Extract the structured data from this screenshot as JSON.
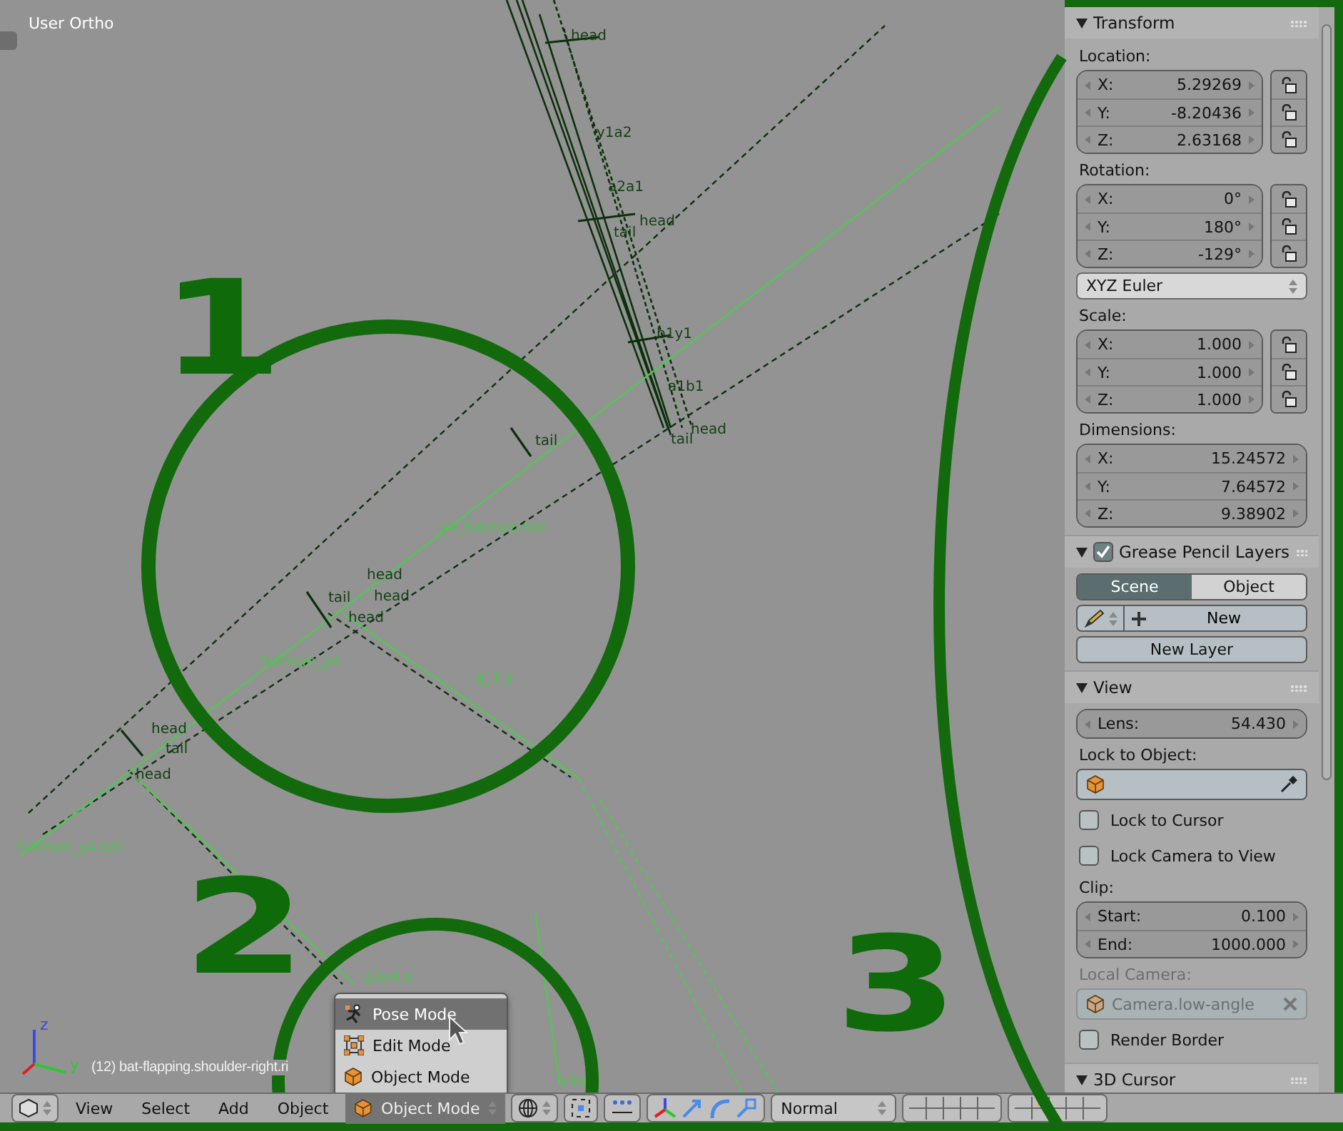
{
  "viewport": {
    "title": "User Ortho",
    "object_info": "(12) bat-flapping.shoulder-right.ri",
    "axis_labels": [
      "z",
      "y"
    ],
    "bone_labels": [
      {
        "text": "head",
        "selected": false
      },
      {
        "text": "y1a2",
        "selected": false
      },
      {
        "text": "a2a1",
        "selected": false
      },
      {
        "text": "head",
        "selected": false
      },
      {
        "text": "tail",
        "selected": false
      },
      {
        "text": "b1y1",
        "selected": false
      },
      {
        "text": "a1b1",
        "selected": false
      },
      {
        "text": "head",
        "selected": false
      },
      {
        "text": "tail",
        "selected": false
      },
      {
        "text": "tail",
        "selected": false
      },
      {
        "text": "y4_fulcrum.tail",
        "selected": true
      },
      {
        "text": "head",
        "selected": false
      },
      {
        "text": "tail",
        "selected": false
      },
      {
        "text": "head",
        "selected": false
      },
      {
        "text": "fulcrum_y4",
        "selected": true
      },
      {
        "text": "g_1.y",
        "selected": true
      },
      {
        "text": "head",
        "selected": false
      },
      {
        "text": "tail",
        "selected": false
      },
      {
        "text": "head",
        "selected": false
      },
      {
        "text": "head",
        "selected": false
      },
      {
        "text": "fulcrum_y4.tail",
        "selected": true
      },
      {
        "text": "g3y4.x",
        "selected": true
      },
      {
        "text": "y3o",
        "selected": true
      }
    ],
    "annotations": [
      {
        "text": "1"
      },
      {
        "text": "2"
      },
      {
        "text": "3"
      }
    ],
    "mode_menu": [
      {
        "label": "Pose Mode",
        "kind": "pose",
        "selected": true
      },
      {
        "label": "Edit Mode",
        "kind": "edit",
        "selected": false
      },
      {
        "label": "Object Mode",
        "kind": "object",
        "selected": false
      }
    ]
  },
  "sidebar": {
    "transform": {
      "title": "Transform",
      "expanded": true,
      "groups": [
        {
          "label": "Location:",
          "locks": true,
          "fields": [
            {
              "axis": "X:",
              "value": "5.29269"
            },
            {
              "axis": "Y:",
              "value": "-8.20436"
            },
            {
              "axis": "Z:",
              "value": "2.63168"
            }
          ]
        },
        {
          "label": "Rotation:",
          "locks": true,
          "fields": [
            {
              "axis": "X:",
              "value": "0°"
            },
            {
              "axis": "Y:",
              "value": "180°"
            },
            {
              "axis": "Z:",
              "value": "-129°"
            }
          ],
          "mode": "XYZ Euler"
        },
        {
          "label": "Scale:",
          "locks": true,
          "fields": [
            {
              "axis": "X:",
              "value": "1.000"
            },
            {
              "axis": "Y:",
              "value": "1.000"
            },
            {
              "axis": "Z:",
              "value": "1.000"
            }
          ]
        },
        {
          "label": "Dimensions:",
          "locks": false,
          "fields": [
            {
              "axis": "X:",
              "value": "15.24572"
            },
            {
              "axis": "Y:",
              "value": "7.64572"
            },
            {
              "axis": "Z:",
              "value": "9.38902"
            }
          ]
        }
      ]
    },
    "grease_pencil": {
      "title": "Grease Pencil Layers",
      "expanded": true,
      "enabled": true,
      "tabs": [
        {
          "label": "Scene",
          "selected": true
        },
        {
          "label": "Object",
          "selected": false
        }
      ],
      "new_button": "New",
      "new_layer_button": "New Layer"
    },
    "view": {
      "title": "View",
      "expanded": true,
      "lens": {
        "label": "Lens:",
        "value": "54.430"
      },
      "lock_to_object_label": "Lock to Object:",
      "checkboxes": [
        {
          "label": "Lock to Cursor",
          "checked": false
        },
        {
          "label": "Lock Camera to View",
          "checked": false
        }
      ],
      "clip_label": "Clip:",
      "clip": [
        {
          "label": "Start:",
          "value": "0.100"
        },
        {
          "label": "End:",
          "value": "1000.000"
        }
      ],
      "local_camera_label": "Local Camera:",
      "local_camera": {
        "value": "Camera.low-angle",
        "disabled": true
      },
      "render_border": {
        "label": "Render Border",
        "checked": false
      }
    },
    "cursor": {
      "title": "3D Cursor",
      "expanded": true
    }
  },
  "header": {
    "menus": [
      "View",
      "Select",
      "Add",
      "Object"
    ],
    "mode": "Object Mode",
    "pivot": "Normal"
  }
}
